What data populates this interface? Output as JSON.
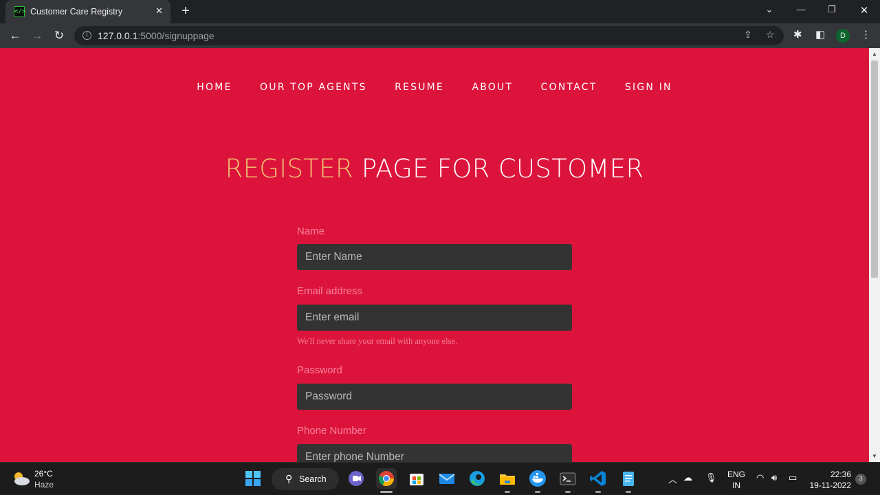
{
  "browser": {
    "tab_title": "Customer Care Registry",
    "url_host": "127.0.0.1",
    "url_path": ":5000/signuppage",
    "profile_initial": "D"
  },
  "site": {
    "nav": [
      "HOME",
      "OUR TOP AGENTS",
      "RESUME",
      "ABOUT",
      "CONTACT",
      "SIGN IN"
    ],
    "heading_accent": "REGISTER",
    "heading_rest": "PAGE FOR CUSTOMER",
    "form": {
      "name_label": "Name",
      "name_placeholder": "Enter Name",
      "email_label": "Email address",
      "email_placeholder": "Enter email",
      "email_help": "We'll never share your email with anyone else.",
      "password_label": "Password",
      "password_placeholder": "Password",
      "phone_label": "Phone Number",
      "phone_placeholder": "Enter phone Number"
    },
    "colors": {
      "background": "#dc143c",
      "accent": "#f0c070",
      "field": "#333333",
      "label": "#f7809a"
    }
  },
  "taskbar": {
    "weather_temp": "26°C",
    "weather_desc": "Haze",
    "search_label": "Search",
    "lang_line1": "ENG",
    "lang_line2": "IN",
    "time": "22:36",
    "date": "19-11-2022",
    "notification_count": "3"
  }
}
